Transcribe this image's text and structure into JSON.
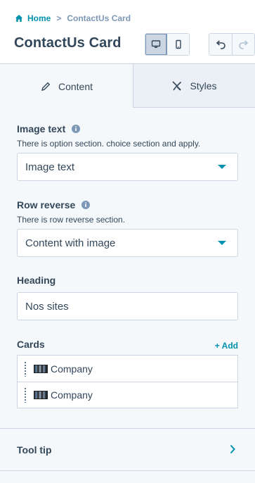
{
  "breadcrumb": {
    "home": "Home",
    "separator": ">",
    "current": "ContactUs Card"
  },
  "header": {
    "title": "ContactUs Card"
  },
  "tabs": [
    {
      "label": "Content",
      "icon": "pencil-icon",
      "active": true
    },
    {
      "label": "Styles",
      "icon": "brush-icon",
      "active": false
    }
  ],
  "fields": {
    "image_text": {
      "label": "Image text",
      "help": "There is option section. choice section and apply.",
      "value": "Image text"
    },
    "row_reverse": {
      "label": "Row reverse",
      "help": "There is row reverse section.",
      "value": "Content with image"
    },
    "heading": {
      "label": "Heading",
      "value": "Nos sites"
    },
    "cards": {
      "label": "Cards",
      "add_label": "+ Add",
      "items": [
        {
          "label": "Company"
        },
        {
          "label": "Company"
        }
      ]
    },
    "tooltip": {
      "label": "Tool tip"
    }
  },
  "colors": {
    "accent": "#0091ae",
    "text": "#33475b",
    "muted": "#7c98b6",
    "border": "#cbd6e2",
    "panel_bg": "#f5f8fa"
  }
}
